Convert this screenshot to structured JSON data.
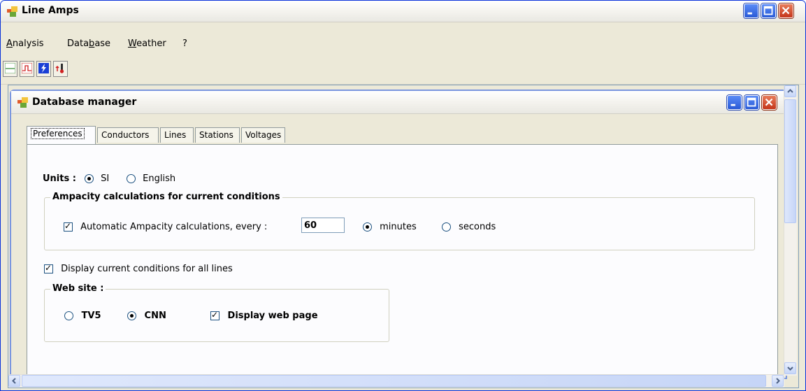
{
  "app": {
    "title": "Line Amps",
    "menu": [
      {
        "label": "Analysis",
        "underline": "A"
      },
      {
        "label": "Database",
        "underline": "b"
      },
      {
        "label": "Weather",
        "underline": "W"
      },
      {
        "label": "?",
        "underline": ""
      }
    ],
    "toolbar": [
      "line-chart-icon",
      "pulse-chart-icon",
      "lightning-icon",
      "temperature-icon"
    ]
  },
  "child_window": {
    "title": "Database manager",
    "tabs": [
      "Preferences",
      "Conductors",
      "Lines",
      "Stations",
      "Voltages"
    ],
    "active_tab": "Preferences"
  },
  "preferences": {
    "units_label": "Units :",
    "units_options": [
      "SI",
      "English"
    ],
    "units_selected": "SI",
    "ampacity_group_title": "Ampacity calculations for current conditions",
    "auto_calc_label": "Automatic Ampacity calculations, every :",
    "auto_calc_checked": true,
    "interval_value": "60",
    "interval_units": [
      "minutes",
      "seconds"
    ],
    "interval_unit_selected": "minutes",
    "display_all_label": "Display current conditions for all lines",
    "display_all_checked": true,
    "website_group_title": "Web site :",
    "website_options": [
      "TV5",
      "CNN"
    ],
    "website_selected": "CNN",
    "display_web_label": "Display web page",
    "display_web_checked": true
  },
  "colors": {
    "xp_blue": "#2859d6",
    "close_red": "#c4351a",
    "window_face": "#ece9d8"
  }
}
